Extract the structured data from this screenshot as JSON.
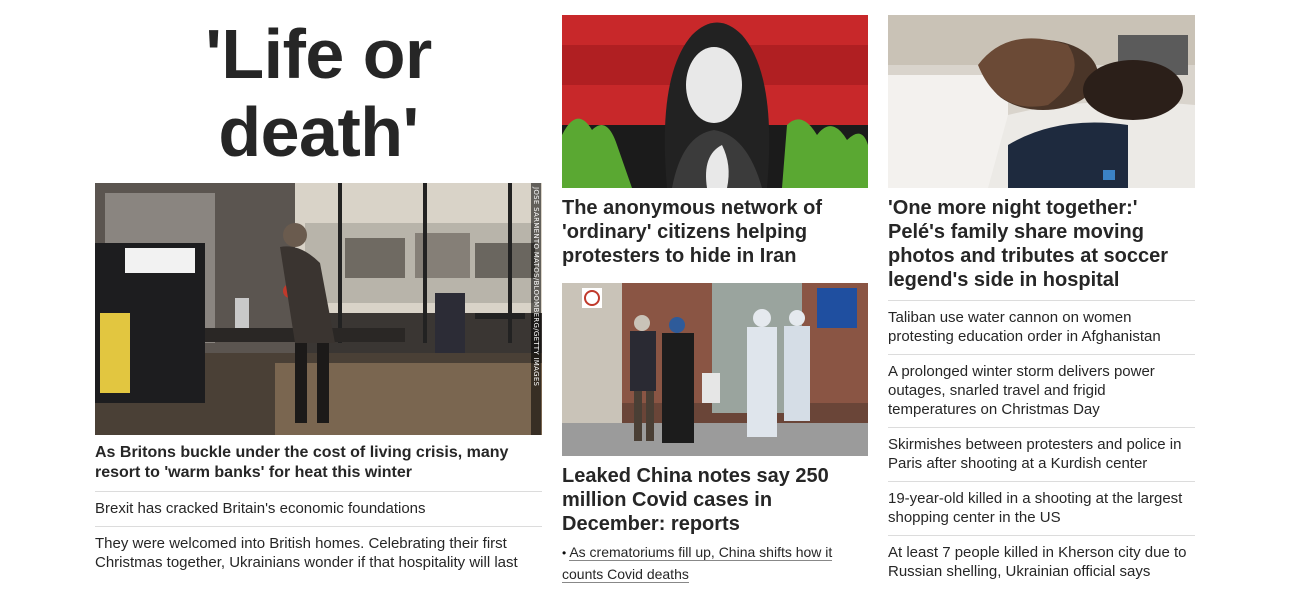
{
  "left": {
    "big_headline": "'Life or death'",
    "photo_credit": "JOSE SARMENTO MATOS/BLOOMBERG/GETTY IMAGES",
    "main_headline": "As Britons buckle under the cost of living crisis, many resort to 'warm banks' for heat this winter",
    "links": [
      "Brexit has cracked Britain's economic foundations",
      "They were welcomed into British homes. Celebrating their first Christmas together, Ukrainians wonder if that hospitality will last"
    ]
  },
  "middle": {
    "story1_headline": "The anonymous network of 'ordinary' citizens helping protesters to hide in Iran",
    "story2_headline": "Leaked China notes say 250 million Covid cases in December: reports",
    "story2_bullet": "•",
    "story2_sublink": "As crematoriums fill up, China shifts how it counts Covid deaths"
  },
  "right": {
    "story_headline": "'One more night together:' Pelé's family share moving photos and tributes at soccer legend's side in hospital",
    "links": [
      "Taliban use water cannon on women protesting education order in Afghanistan",
      "A prolonged winter storm delivers power outages, snarled travel and frigid temperatures on Christmas Day",
      "Skirmishes between protesters and police in Paris after shooting at a Kurdish center",
      "19-year-old killed in a shooting at the largest shopping center in the US",
      "At least 7 people killed in Kherson city due to Russian shelling, Ukrainian official says"
    ]
  },
  "colors": {
    "text": "#262626",
    "divider": "#dcdcdc",
    "iran_red": "#c8282a",
    "iran_green": "#5aa832"
  }
}
